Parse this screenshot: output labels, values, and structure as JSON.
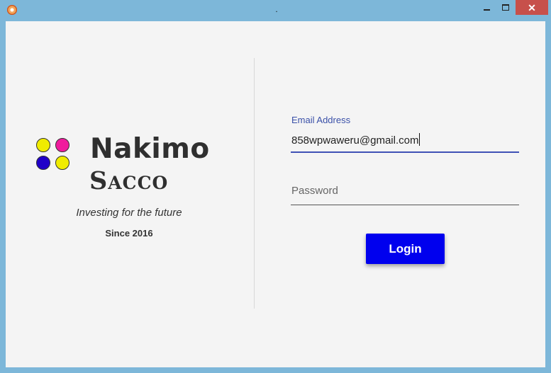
{
  "window": {
    "title": ".",
    "close_glyph": "✕"
  },
  "logo": {
    "brand_name": "Nakimo",
    "brand_sub": "Sacco",
    "dot_colors": {
      "top_left": "#f0ec00",
      "top_right": "#ef1b9d",
      "bottom_left": "#2000c8",
      "bottom_right": "#f0ec00"
    },
    "tagline": "Investing for the future",
    "since": "Since 2016"
  },
  "form": {
    "email_label": "Email Address",
    "email_value": "858wpwaweru@gmail.com",
    "password_placeholder": "Password",
    "login_label": "Login"
  },
  "colors": {
    "accent": "#3f51b5",
    "login_button": "#0000ee",
    "close_button": "#c7504b"
  }
}
